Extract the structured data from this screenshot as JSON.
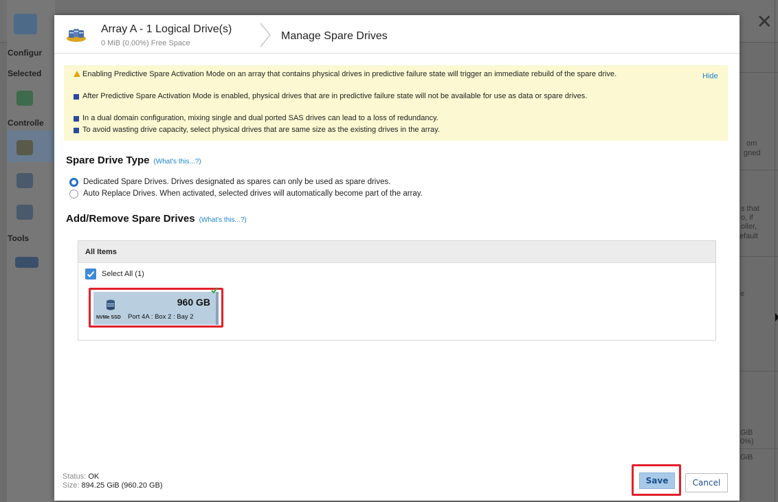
{
  "background": {
    "labels": {
      "configure": "Configur",
      "selected": "Selected",
      "controllers": "Controlle",
      "tools": "Tools"
    },
    "right_fragments": {
      "f1": "om",
      "f2": "gned",
      "f3": "s that",
      "f4": "o, if",
      "f5": "oller,",
      "f6": "efault",
      "f7": "e",
      "f8": "GiB",
      "f9": "0%)",
      "f10": "GiB"
    }
  },
  "modal": {
    "header": {
      "title": "Array A - 1 Logical Drive(s)",
      "subtitle": "0 MiB (0.00%) Free Space",
      "page_title": "Manage Spare Drives"
    },
    "notice": {
      "hide_label": "Hide",
      "items": [
        "Enabling Predictive Spare Activation Mode on an array that contains physical drives in predictive failure state will trigger an immediate rebuild of the spare drive.",
        "After Predictive Spare Activation Mode is enabled, physical drives that are in predictive failure state will not be available for use as data or spare drives.",
        "In a dual domain configuration, mixing single and dual ported SAS drives can lead to a loss of redundancy.",
        "To avoid wasting drive capacity, select physical drives that are same size as the existing drives in the array."
      ]
    },
    "spare_type": {
      "title": "Spare Drive Type",
      "help": "(What's this...?)",
      "options": [
        "Dedicated Spare Drives. Drives designated as spares can only be used as spare drives.",
        "Auto Replace Drives. When activated, selected drives will automatically become part of the array."
      ]
    },
    "add_remove": {
      "title": "Add/Remove Spare Drives",
      "help": "(What's this...?)",
      "panel_header": "All Items",
      "select_all": "Select All (1)",
      "drive": {
        "size": "960 GB",
        "type": "NVMe SSD",
        "location": "Port 4A : Box 2 : Bay 2"
      }
    },
    "footer": {
      "status_label": "Status:",
      "status_value": "OK",
      "size_label": "Size:",
      "size_value": "894.25 GiB (960.20 GB)",
      "save_label": "Save",
      "cancel_label": "Cancel"
    }
  },
  "colors": {
    "accent": "#1f82c9",
    "highlight": "#e3202b",
    "notice_bg": "#fbf8d2"
  }
}
